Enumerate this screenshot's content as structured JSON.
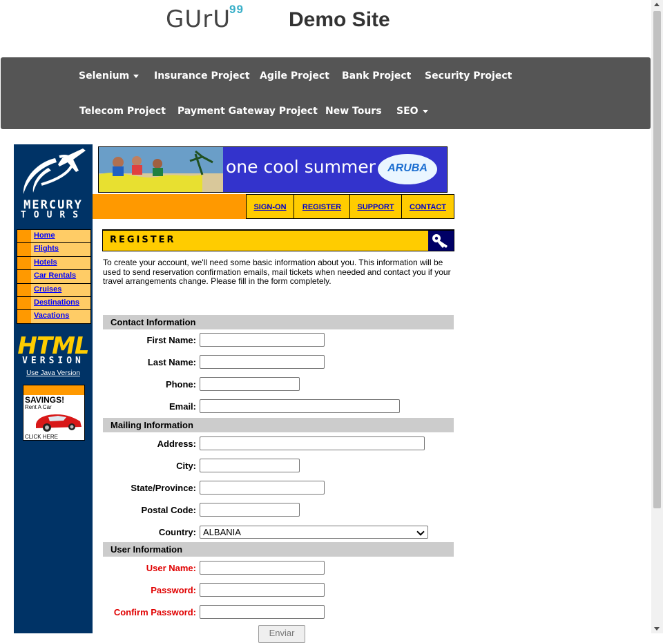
{
  "header": {
    "logo_text": "GUrU",
    "logo_sup": "99",
    "site_title": "Demo Site"
  },
  "nav": {
    "row1": [
      "Selenium",
      "Insurance Project",
      "Agile Project",
      "Bank Project",
      "Security Project"
    ],
    "row2": [
      "Telecom Project",
      "Payment Gateway Project",
      "New Tours",
      "SEO"
    ]
  },
  "sidebar": {
    "logo_word1": "MERCURY",
    "logo_word2": "TOURS",
    "menu": [
      "Home",
      "Flights",
      "Hotels",
      "Car Rentals",
      "Cruises",
      "Destinations",
      "Vacations"
    ],
    "html_text": "HTML",
    "version_text": "VERSION",
    "java_link": "Use Java Version",
    "ad": {
      "title": "SAVINGS!",
      "sub": "Rent A Car",
      "click": "CLICK HERE"
    }
  },
  "banner": {
    "text": "one cool summer",
    "brand": "ARUBA"
  },
  "tabs": [
    "SIGN-ON",
    "REGISTER",
    "SUPPORT",
    "CONTACT"
  ],
  "register": {
    "title": "REGISTER",
    "intro": "To create your account, we'll need some basic information about you. This information will be used to send reservation confirmation emails, mail tickets when needed and contact you if your travel arrangements change. Please fill in the form completely."
  },
  "form": {
    "contact_heading": "Contact Information",
    "first_name": "First Name:",
    "last_name": "Last Name:",
    "phone": "Phone:",
    "email": "Email:",
    "mailing_heading": "Mailing Information",
    "address": "Address:",
    "city": "City:",
    "state": "State/Province:",
    "postal": "Postal Code:",
    "country": "Country:",
    "country_value": "ALBANIA",
    "user_heading": "User Information",
    "user_name": "User Name:",
    "password": "Password:",
    "confirm_password": "Confirm Password:",
    "submit": "Enviar"
  },
  "colors": {
    "navbar": "#555555",
    "sidebar": "#003366",
    "orange": "#ff9900",
    "yellow": "#ffcc00",
    "required_label": "#e00000"
  }
}
